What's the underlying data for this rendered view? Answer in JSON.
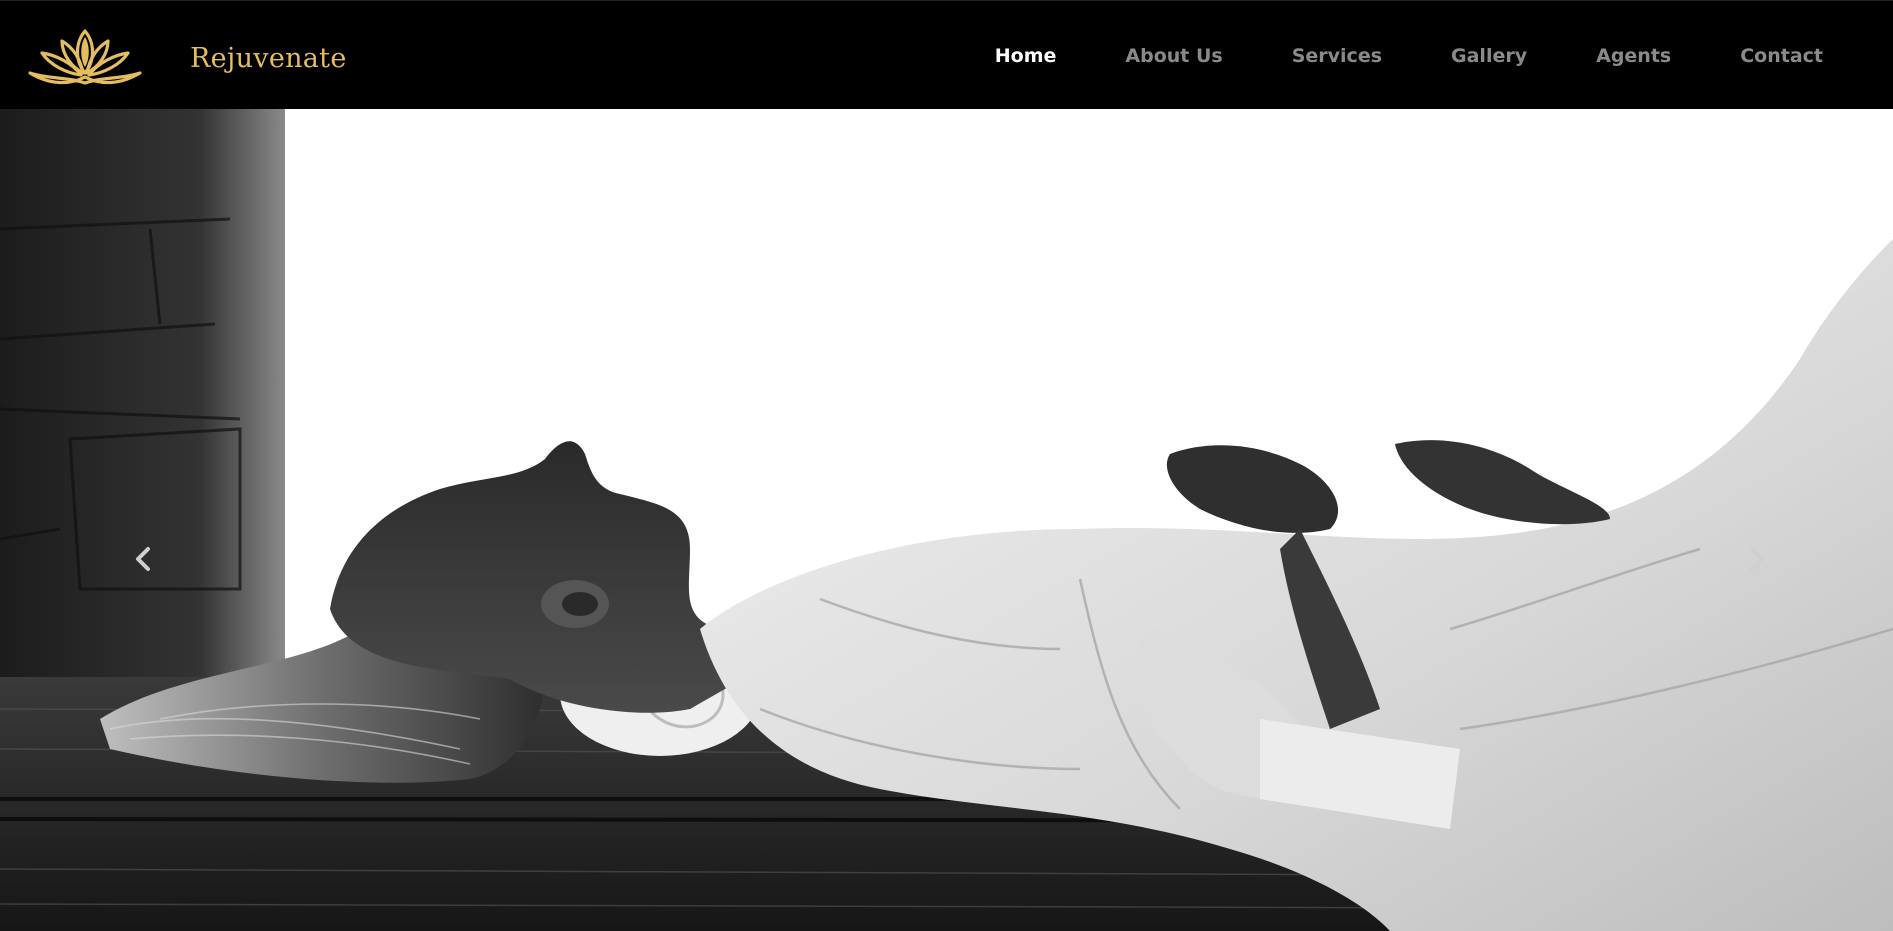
{
  "brand": {
    "name": "Rejuvenate",
    "logo_icon": "lotus-icon",
    "color": "#e3bd5e"
  },
  "nav": {
    "items": [
      {
        "label": "Home",
        "active": true
      },
      {
        "label": "About Us",
        "active": false
      },
      {
        "label": "Services",
        "active": false
      },
      {
        "label": "Gallery",
        "active": false
      },
      {
        "label": "Agents",
        "active": false
      },
      {
        "label": "Contact",
        "active": false
      }
    ]
  },
  "carousel": {
    "prev_icon": "chevron-left-icon",
    "next_icon": "chevron-right-icon"
  }
}
